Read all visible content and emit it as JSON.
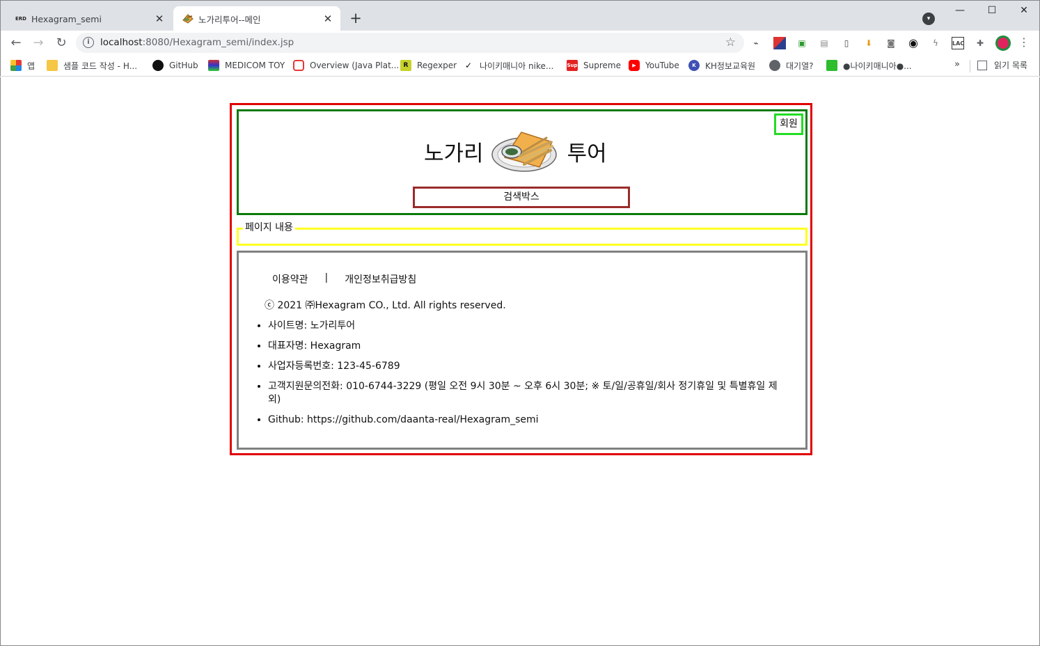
{
  "browser": {
    "tabs": [
      {
        "favicon": "ERD",
        "title": "Hexagram_semi",
        "active": false
      },
      {
        "favicon": "food-icon",
        "title": "노가리투어--메인",
        "active": true
      }
    ],
    "url_host": "localhost",
    "url_rest": ":8080/Hexagram_semi/index.jsp",
    "bookmarks": [
      {
        "icon": "apps-icon",
        "label": "앱"
      },
      {
        "icon": "folder-icon",
        "label": "샘플 코드 작성 - H..."
      },
      {
        "icon": "github-icon",
        "label": "GitHub"
      },
      {
        "icon": "medicom-icon",
        "label": "MEDICOM TOY"
      },
      {
        "icon": "oracle-icon",
        "label": "Overview (Java Plat..."
      },
      {
        "icon": "regex-icon",
        "label": "Regexper"
      },
      {
        "icon": "nike-icon",
        "label": "나이키매니아 nike..."
      },
      {
        "icon": "supreme-icon",
        "label": "Supreme"
      },
      {
        "icon": "youtube-icon",
        "label": "YouTube"
      },
      {
        "icon": "kh-icon",
        "label": "KH정보교육원"
      },
      {
        "icon": "globe-icon",
        "label": "대기열?"
      },
      {
        "icon": "chat-icon",
        "label": "●나이키매니아●..."
      }
    ],
    "bookmarks_more": "»",
    "reading_list": "읽기 목록"
  },
  "page": {
    "login_label": "회원",
    "logo_left": "노가리",
    "logo_right": "투어",
    "search_label": "검색박스",
    "content_legend": "페이지 내용",
    "footer": {
      "terms": "이용약관",
      "separator": "|",
      "privacy": "개인정보취급방침",
      "copyright": "ⓒ 2021 ㈜Hexagram CO., Ltd. All rights reserved.",
      "items": [
        "사이트명: 노가리투어",
        "대표자명: Hexagram",
        "사업자등록번호: 123-45-6789",
        "고객지원문의전화: 010-6744-3229 (평일 오전 9시 30분 ~ 오후 6시 30분; ※ 토/일/공휴일/회사 정기휴일 및 특별휴일 제외)",
        "Github:  https://github.com/daanta-real/Hexagram_semi"
      ]
    }
  }
}
